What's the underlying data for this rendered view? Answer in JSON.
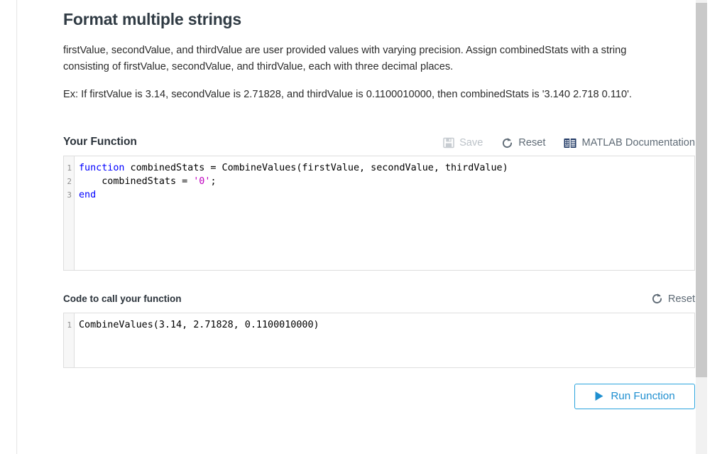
{
  "page": {
    "title": "Format multiple strings",
    "description_1": "firstValue, secondValue, and thirdValue are user provided values with varying precision. Assign combinedStats with a string consisting of firstValue, secondValue, and thirdValue, each with three decimal places.",
    "description_2": "Ex: If firstValue is 3.14, secondValue is 2.71828, and thirdValue is 0.1100010000, then combinedStats is '3.140 2.718 0.110'."
  },
  "your_function": {
    "section_title": "Your Function",
    "toolbar": {
      "save_label": "Save",
      "save_icon": "floppy-disk-icon",
      "save_disabled": true,
      "reset_label": "Reset",
      "reset_icon": "refresh-circular-arrow-icon",
      "docs_label": "MATLAB Documentation",
      "docs_icon": "book-icon"
    },
    "editor": {
      "line_numbers": [
        "1",
        "2",
        "3"
      ],
      "lines": [
        [
          {
            "t": "function",
            "c": "kw"
          },
          {
            "t": " combinedStats = CombineValues(firstValue, secondValue, thirdValue)",
            "c": ""
          }
        ],
        [
          {
            "t": "    combinedStats = ",
            "c": ""
          },
          {
            "t": "'0'",
            "c": "str"
          },
          {
            "t": ";",
            "c": ""
          }
        ],
        [
          {
            "t": "end",
            "c": "kw"
          }
        ]
      ]
    }
  },
  "call_function": {
    "section_title": "Code to call your function",
    "toolbar": {
      "reset_label": "Reset",
      "reset_icon": "refresh-circular-arrow-icon"
    },
    "editor": {
      "line_numbers": [
        "1"
      ],
      "lines": [
        [
          {
            "t": "CombineValues(3.14, 2.71828, 0.1100010000)",
            "c": ""
          }
        ]
      ]
    }
  },
  "run": {
    "label": "Run Function",
    "icon": "play-triangle-icon"
  },
  "colors": {
    "accent_blue": "#29a3dd",
    "keyword_blue": "#0000ff",
    "string_magenta": "#bf00bf",
    "title_dark": "#303b44",
    "muted_grey": "#5e6a75",
    "disabled_grey": "#bcc2c8",
    "book_icon_navy": "#1f3864"
  },
  "scrollbar": {
    "orientation": "vertical",
    "position": "right"
  }
}
